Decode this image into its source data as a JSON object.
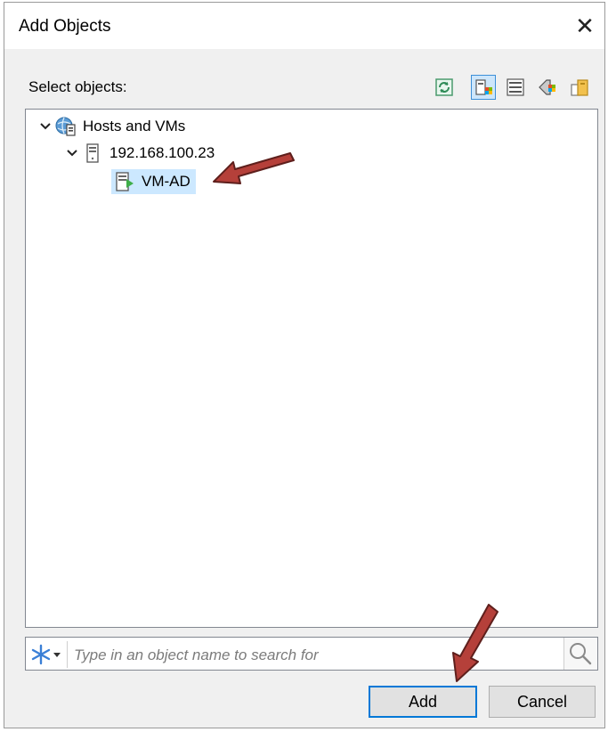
{
  "dialog": {
    "title": "Add Objects",
    "close_glyph": "✕",
    "select_label": "Select objects:"
  },
  "toolbar": {
    "buttons": [
      {
        "icon": "refresh-icon",
        "active": false
      },
      {
        "icon": "hosts-and-clusters-view-icon",
        "active": true
      },
      {
        "icon": "vms-and-templates-view-icon",
        "active": false
      },
      {
        "icon": "tags-view-icon",
        "active": false
      },
      {
        "icon": "datastores-view-icon",
        "active": false
      }
    ]
  },
  "tree": {
    "root": {
      "label": "Hosts and VMs",
      "expanded": true
    },
    "host": {
      "label": "192.168.100.23",
      "expanded": true
    },
    "vm": {
      "label": "VM-AD",
      "selected": true
    }
  },
  "search": {
    "placeholder": "Type in an object name to search for",
    "value": ""
  },
  "buttons": {
    "add": "Add",
    "cancel": "Cancel"
  },
  "colors": {
    "annotation_arrow": "#b5403a",
    "selection": "#cce8ff",
    "focus_border": "#0078d7"
  }
}
